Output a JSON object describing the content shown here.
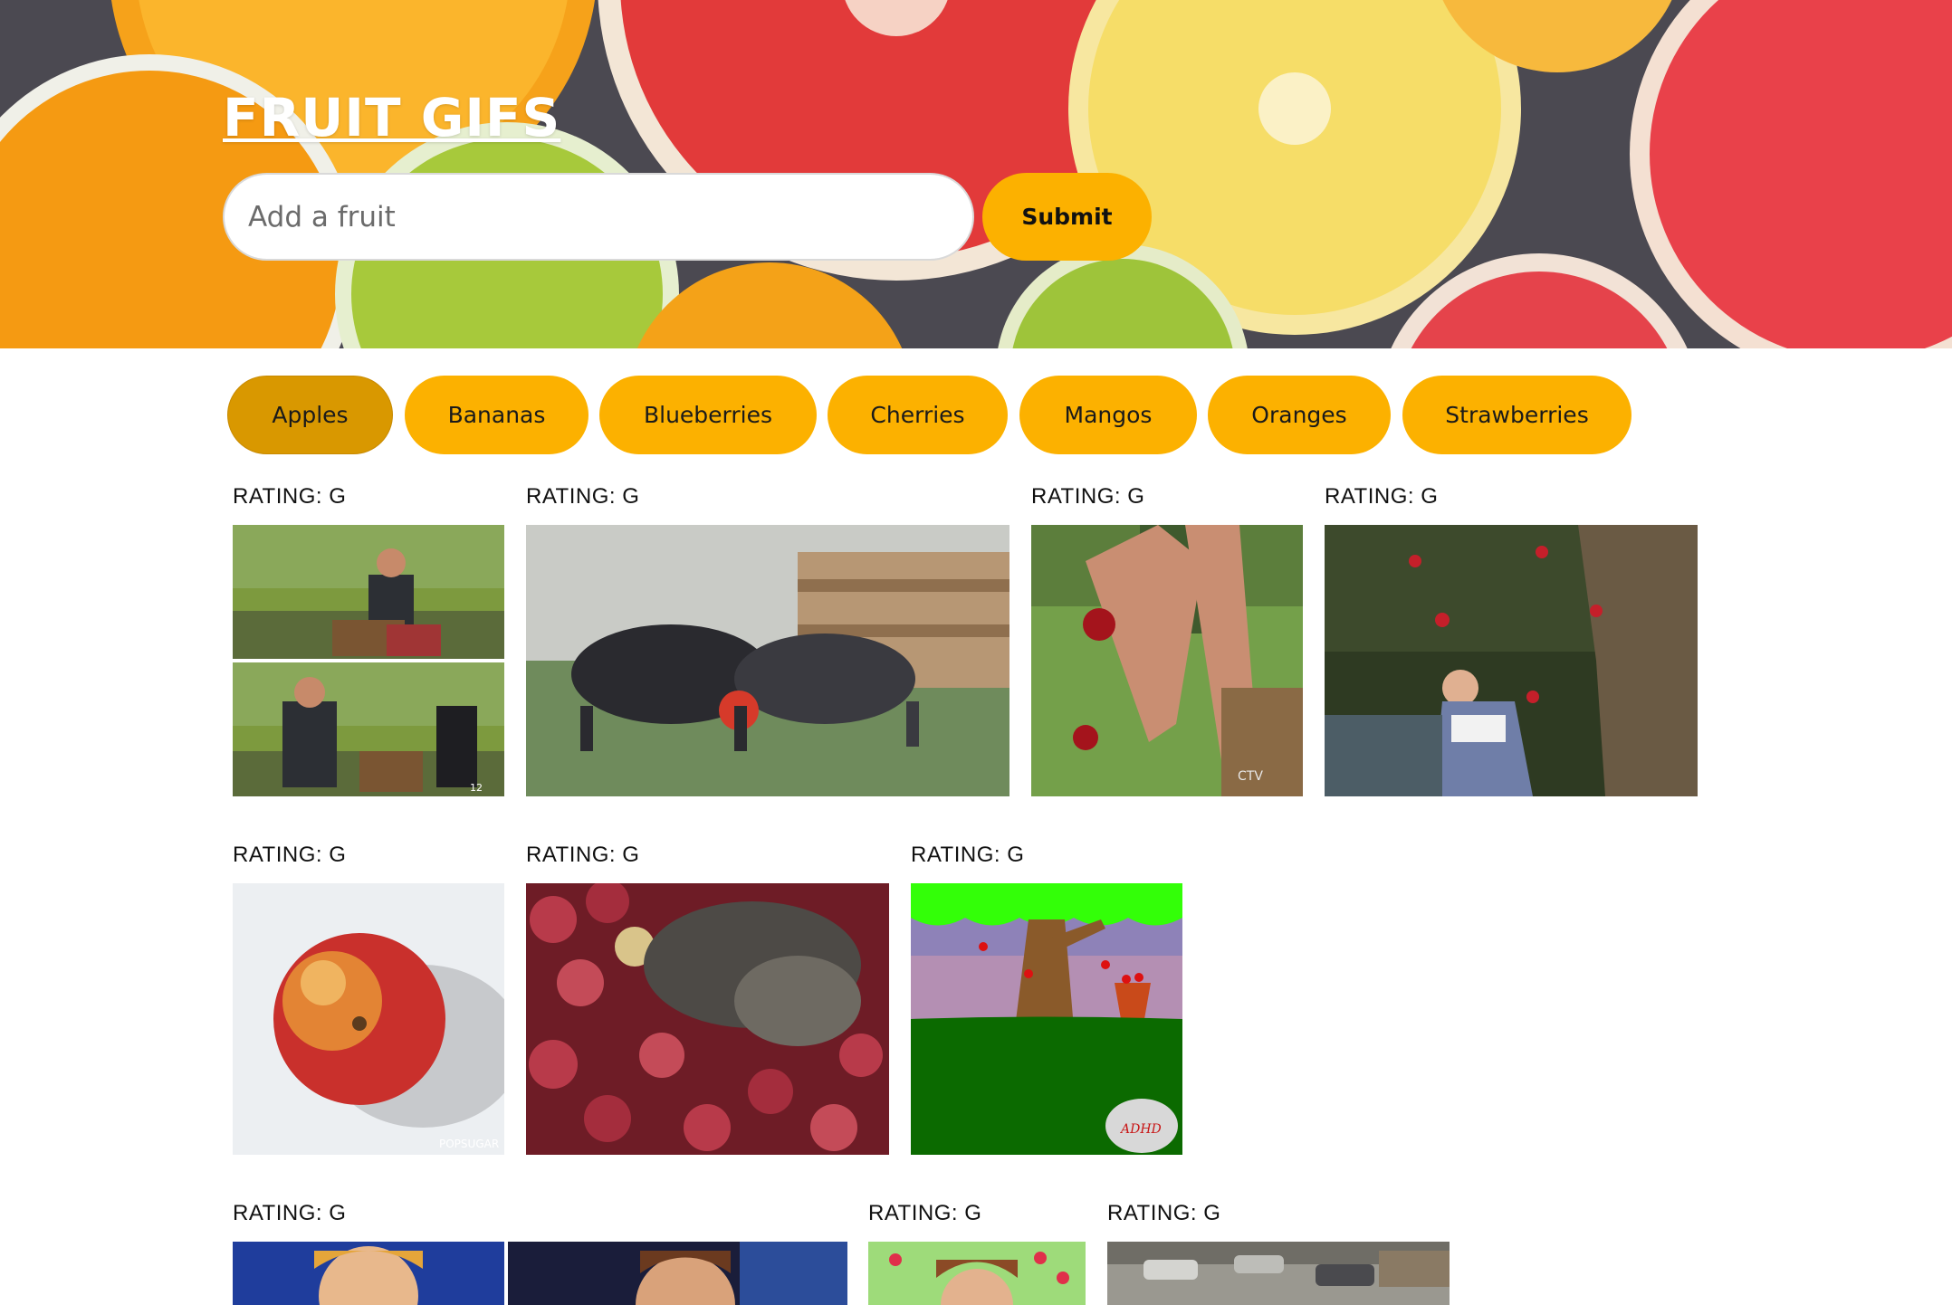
{
  "header": {
    "title": "FRUIT GIFS",
    "search_placeholder": "Add a fruit",
    "submit_label": "Submit"
  },
  "fruits": [
    {
      "label": "Apples",
      "active": true
    },
    {
      "label": "Bananas",
      "active": false
    },
    {
      "label": "Blueberries",
      "active": false
    },
    {
      "label": "Cherries",
      "active": false
    },
    {
      "label": "Mangos",
      "active": false
    },
    {
      "label": "Oranges",
      "active": false
    },
    {
      "label": "Strawberries",
      "active": false
    }
  ],
  "gifs": [
    {
      "rating": "RATING: G",
      "watermark": "12"
    },
    {
      "rating": "RATING: G",
      "watermark": ""
    },
    {
      "rating": "RATING: G",
      "watermark": "CTV"
    },
    {
      "rating": "RATING: G",
      "watermark": ""
    },
    {
      "rating": "RATING: G",
      "watermark": "POPSUGAR"
    },
    {
      "rating": "RATING: G",
      "watermark": ""
    },
    {
      "rating": "RATING: G",
      "watermark": "ADHD"
    },
    {
      "rating": "RATING: G",
      "watermark": ""
    },
    {
      "rating": "RATING: G",
      "watermark": ""
    },
    {
      "rating": "RATING: G",
      "watermark": ""
    }
  ],
  "colors": {
    "accent": "#fcb100",
    "accent_active": "#d99800"
  }
}
